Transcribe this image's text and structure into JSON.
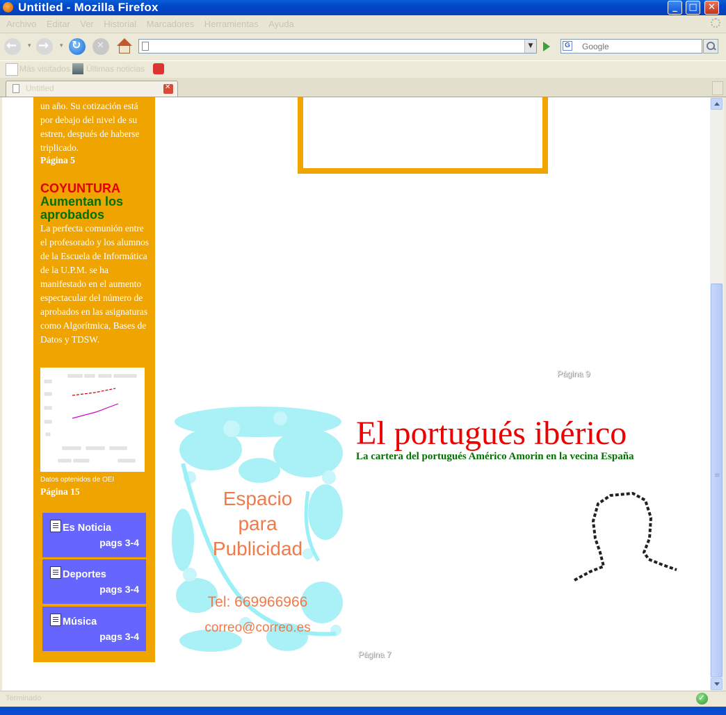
{
  "window": {
    "title": "Untitled - Mozilla Firefox"
  },
  "menu": [
    "Archivo",
    "Editar",
    "Ver",
    "Historial",
    "Marcadores",
    "Herramientas",
    "Ayuda"
  ],
  "toolbar": {
    "url": "",
    "search_placeholder": "Google",
    "search_engine_letter": "G"
  },
  "bookmarks": [
    "Más visitados",
    "Últimas noticias"
  ],
  "tab": {
    "label": "Untitled"
  },
  "status": {
    "text": "Terminado"
  },
  "sidebar": {
    "intro_text": "un año. Su cotización está por debajo del nivel de su estren, después de haberse triplicado.",
    "intro_page": "Página 5",
    "section": "COYUNTURA",
    "headline": "Aumentan los aprobados",
    "body": "La perfecta comunión entre el profesorado y los alumnos de la Escuela de Informática de la U.P.M. se ha manifestado en el aumento espectacular del número de aprobados en las asignaturas como Algorítmica, Bases de Datos y TDSW.",
    "chart_source": "Datos optenidos de OEI",
    "chart_page": "Página 15",
    "nav": [
      {
        "title": "Es Noticia",
        "pages": "pags 3-4"
      },
      {
        "title": "Deportes",
        "pages": "pags 3-4"
      },
      {
        "title": "Música",
        "pages": "pags 3-4"
      }
    ]
  },
  "main": {
    "page_label_top": "Página 9",
    "page_label_bottom": "Página 7",
    "ad": {
      "line1": "Espacio",
      "line2": "para",
      "line3": "Publicidad",
      "phone": "Tel: 669966966",
      "email": "correo@correo.es"
    },
    "article": {
      "title": "El portugués ibérico",
      "subtitle": "La cartera del portugués Américo Amorin en la vecina España"
    }
  },
  "colors": {
    "sidebar": "#f0a400",
    "nav_box": "#6666ff",
    "title_red": "#ee0000",
    "headline_green": "#007000",
    "ad_text": "#f07a4a"
  }
}
